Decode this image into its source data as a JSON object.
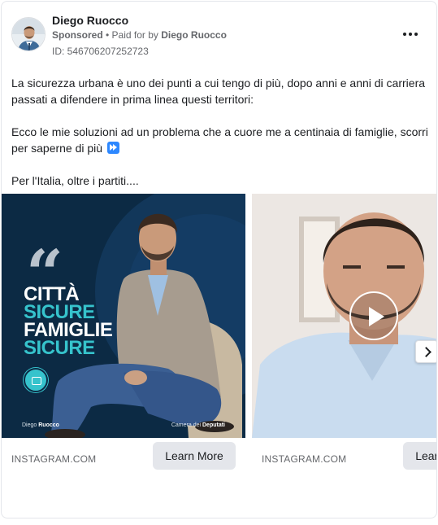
{
  "ad": {
    "advertiser_name": "Diego Ruocco",
    "sponsored_label": "Sponsored",
    "separator": " • ",
    "paid_for_prefix": "Paid for by ",
    "paid_for_by": "Diego Ruocco",
    "library_id": "ID: 546706207252723",
    "icons": {
      "more": "more-options-icon",
      "fast_forward": "fast-forward-emoji-icon",
      "play": "play-icon",
      "next": "chevron-right-icon"
    }
  },
  "body": {
    "paragraph_1": "La sicurezza urbana è uno dei punti a cui tengo di più, dopo anni e anni di carriera passati a difendere in prima linea questi territori:",
    "paragraph_2": "Ecco le mie soluzioni ad un problema che a cuore me a centinaia di famiglie, scorri per saperne di più",
    "paragraph_3": "Per l'Italia, oltre i partiti...."
  },
  "carousel": {
    "cards": [
      {
        "poster": {
          "line_1": "CITTÀ",
          "line_2": "SICURE",
          "line_3": "FAMIGLIE",
          "line_4": "SICURE",
          "footer_left_1": "Diego ",
          "footer_left_2": "Ruocco",
          "footer_right_1": "Camera dei ",
          "footer_right_2": "Deputati"
        },
        "domain": "INSTAGRAM.COM",
        "cta_label": "Learn More"
      },
      {
        "domain": "INSTAGRAM.COM",
        "cta_label": "Learn More"
      }
    ]
  },
  "colors": {
    "poster_background": "#0c2a44",
    "poster_accent": "#36c3cc",
    "cta_background": "#e4e6eb",
    "secondary_text": "#65676b"
  }
}
